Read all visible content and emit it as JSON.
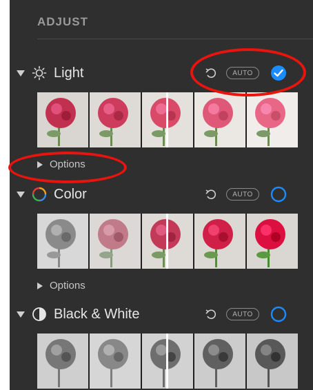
{
  "header": {
    "title": "ADJUST"
  },
  "sections": [
    {
      "title": "Light",
      "icon": "sun-icon",
      "auto_label": "AUTO",
      "enabled": true,
      "options_label": "Options",
      "tone": "color"
    },
    {
      "title": "Color",
      "icon": "color-wheel-icon",
      "auto_label": "AUTO",
      "enabled": false,
      "options_label": "Options",
      "tone": "color"
    },
    {
      "title": "Black & White",
      "icon": "half-circle-icon",
      "auto_label": "AUTO",
      "enabled": false,
      "tone": "bw"
    }
  ],
  "colors": {
    "panel_bg": "#2f2f2f",
    "accent_blue": "#1a8cff",
    "annotation_red": "#e8140e"
  }
}
